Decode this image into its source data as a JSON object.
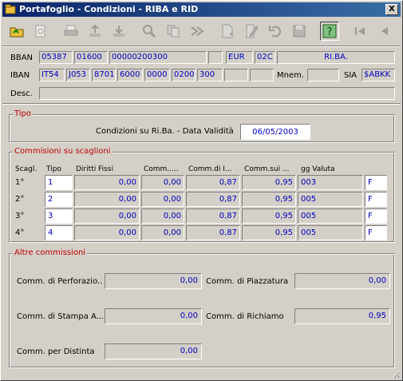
{
  "window": {
    "title": "Portafoglio - Condizioni - RIBA e RID",
    "close_label": "X"
  },
  "toolbar": {
    "buttons": [
      {
        "name": "open-folder-icon"
      },
      {
        "name": "refresh-icon"
      },
      {
        "name": "print-icon"
      },
      {
        "name": "export-icon"
      },
      {
        "name": "import-icon"
      },
      {
        "name": "search-icon"
      },
      {
        "name": "copy-icon"
      },
      {
        "name": "forward-icon"
      },
      {
        "name": "new-document-icon"
      },
      {
        "name": "edit-icon"
      },
      {
        "name": "undo-icon"
      },
      {
        "name": "save-icon"
      },
      {
        "name": "help-icon"
      },
      {
        "name": "first-record-icon"
      },
      {
        "name": "previous-record-icon"
      }
    ]
  },
  "bban": {
    "label": "BBAN",
    "cin": "05387",
    "abi": "01600",
    "conto": "00000200300",
    "blank": "",
    "currency": "EUR",
    "code": "02C",
    "type": "RI.BA."
  },
  "iban": {
    "label": "IBAN",
    "parts": [
      "IT54",
      "J053",
      "8701",
      "6000",
      "0000",
      "0200",
      "300"
    ],
    "blank1": "",
    "blank2": "",
    "mnem_label": "Mnem.",
    "mnem": "",
    "sia_label": "SIA",
    "sia": "$ABKK"
  },
  "desc": {
    "label": "Desc.",
    "value": ""
  },
  "tipo": {
    "legend": "Tipo",
    "text": "Condizioni su Ri.Ba.  -  Data Validità",
    "date": "06/05/2003"
  },
  "scaglioni": {
    "legend": "Commisioni su scaglioni",
    "headers": [
      "Scagl.",
      "Tipo",
      "Diritti Fissi",
      "Comm.....",
      "Comm.di I...",
      "Comm.sui ...",
      "gg Valuta"
    ],
    "rows": [
      {
        "scagl": "1°",
        "tipo": "1",
        "diritti": "0,00",
        "comm1": "0,00",
        "comm2": "0,87",
        "comm3": "0,95",
        "gg": "003",
        "flag": "F"
      },
      {
        "scagl": "2°",
        "tipo": "2",
        "diritti": "0,00",
        "comm1": "0,00",
        "comm2": "0,87",
        "comm3": "0,95",
        "gg": "005",
        "flag": "F"
      },
      {
        "scagl": "3°",
        "tipo": "3",
        "diritti": "0,00",
        "comm1": "0,00",
        "comm2": "0,87",
        "comm3": "0,95",
        "gg": "005",
        "flag": "F"
      },
      {
        "scagl": "4°",
        "tipo": "4",
        "diritti": "0,00",
        "comm1": "0,00",
        "comm2": "0,87",
        "comm3": "0,95",
        "gg": "005",
        "flag": "F"
      }
    ]
  },
  "altre": {
    "legend": "Altre commissioni",
    "perforazione": {
      "label": "Comm. di Perforazio...",
      "value": "0,00"
    },
    "piazzatura": {
      "label": "Comm. di Piazzatura",
      "value": "0,00"
    },
    "stampa": {
      "label": "Comm. di Stampa A...",
      "value": "0,00"
    },
    "richiamo": {
      "label": "Comm. di Richiamo",
      "value": "0,95"
    },
    "distinta": {
      "label": "Comm. per Distinta",
      "value": "0,00"
    }
  }
}
